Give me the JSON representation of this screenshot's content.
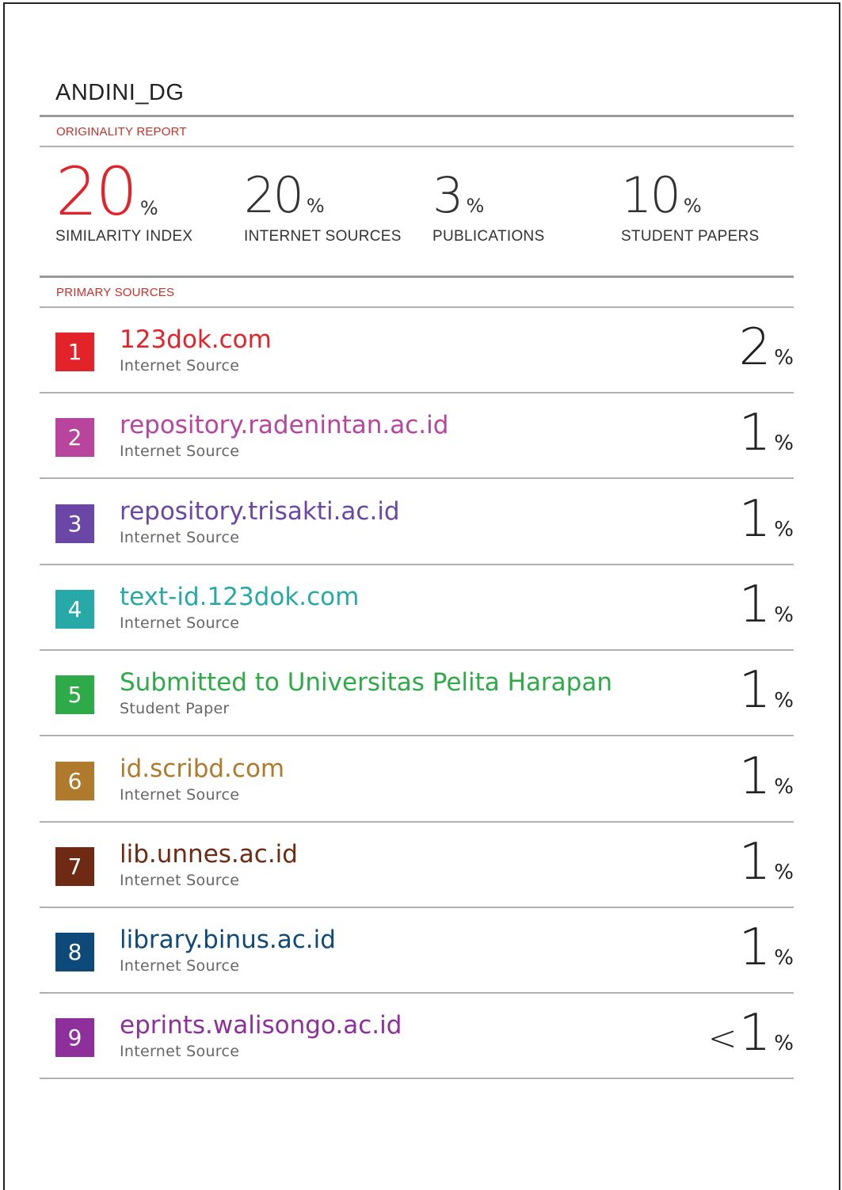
{
  "document": {
    "title": "ANDINI_DG",
    "report_label": "ORIGINALITY REPORT",
    "sources_label": "PRIMARY SOURCES",
    "colors": {
      "accent": "#e3232a",
      "section_label": "#c8302a"
    }
  },
  "stats": [
    {
      "value": "20",
      "pct": "%",
      "label": "SIMILARITY INDEX",
      "color": "#e3232a"
    },
    {
      "value": "20",
      "pct": "%",
      "label": "INTERNET SOURCES",
      "color": "#333333"
    },
    {
      "value": "3",
      "pct": "%",
      "label": "PUBLICATIONS",
      "color": "#333333"
    },
    {
      "value": "10",
      "pct": "%",
      "label": "STUDENT PAPERS",
      "color": "#333333"
    }
  ],
  "sources": [
    {
      "rank": "1",
      "name": "123dok.com",
      "type": "Internet Source",
      "prefix": "",
      "percent": "2",
      "pct": "%",
      "color": "#e3232a"
    },
    {
      "rank": "2",
      "name": "repository.radenintan.ac.id",
      "type": "Internet Source",
      "prefix": "",
      "percent": "1",
      "pct": "%",
      "color": "#b8449e"
    },
    {
      "rank": "3",
      "name": "repository.trisakti.ac.id",
      "type": "Internet Source",
      "prefix": "",
      "percent": "1",
      "pct": "%",
      "color": "#6a47a6"
    },
    {
      "rank": "4",
      "name": "text-id.123dok.com",
      "type": "Internet Source",
      "prefix": "",
      "percent": "1",
      "pct": "%",
      "color": "#27aaa7"
    },
    {
      "rank": "5",
      "name": "Submitted to Universitas Pelita Harapan",
      "type": "Student Paper",
      "prefix": "",
      "percent": "1",
      "pct": "%",
      "color": "#2eaa48"
    },
    {
      "rank": "6",
      "name": "id.scribd.com",
      "type": "Internet Source",
      "prefix": "",
      "percent": "1",
      "pct": "%",
      "color": "#b07a2c"
    },
    {
      "rank": "7",
      "name": "lib.unnes.ac.id",
      "type": "Internet Source",
      "prefix": "",
      "percent": "1",
      "pct": "%",
      "color": "#6e2a12"
    },
    {
      "rank": "8",
      "name": "library.binus.ac.id",
      "type": "Internet Source",
      "prefix": "",
      "percent": "1",
      "pct": "%",
      "color": "#0d4a7a"
    },
    {
      "rank": "9",
      "name": "eprints.walisongo.ac.id",
      "type": "Internet Source",
      "prefix": "<",
      "percent": "1",
      "pct": "%",
      "color": "#8e2f9c"
    }
  ]
}
